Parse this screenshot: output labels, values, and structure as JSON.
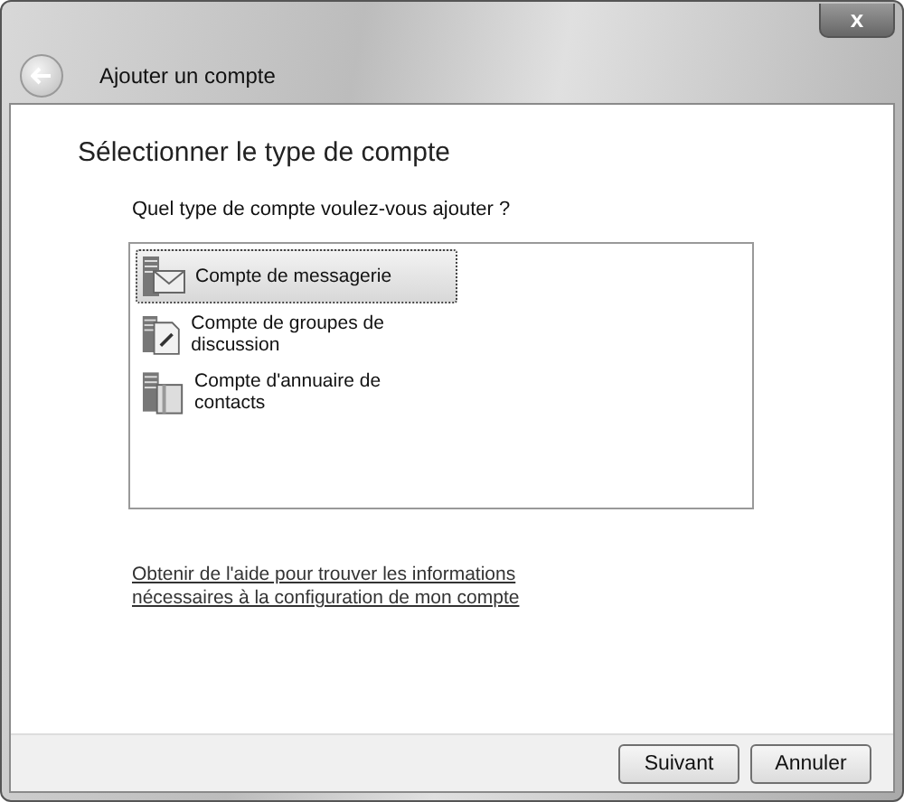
{
  "window": {
    "title": "Ajouter un compte",
    "close": "x"
  },
  "heading": "Sélectionner le type de compte",
  "question": "Quel type de compte voulez-vous ajouter ?",
  "accounts": [
    {
      "label": "Compte de messagerie",
      "kind": "mail",
      "selected": true
    },
    {
      "label": "Compte de groupes de discussion",
      "kind": "news",
      "selected": false
    },
    {
      "label": "Compte d'annuaire de contacts",
      "kind": "directory",
      "selected": false
    }
  ],
  "help_link": "Obtenir de l'aide pour trouver les informations nécessaires à la configuration de mon compte",
  "buttons": [
    "Suivant",
    "Annuler"
  ]
}
